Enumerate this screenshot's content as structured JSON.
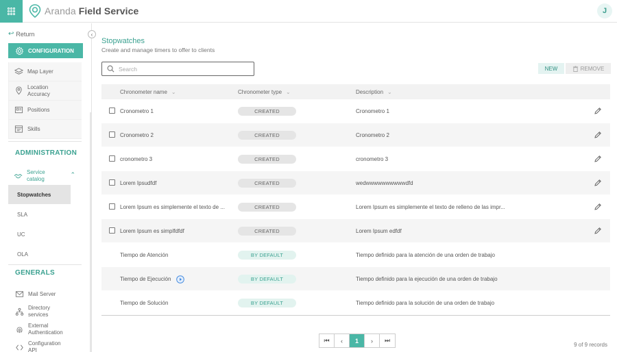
{
  "app": {
    "brand_light": "Aranda",
    "brand_bold": "Field Service",
    "user_initial": "J",
    "accent_color": "#4ab7a6"
  },
  "sidebar": {
    "return_label": "Return",
    "config_label": "CONFIGURATION",
    "config_items": [
      {
        "label": "Map Layer",
        "icon": "map-layer-icon"
      },
      {
        "label": "Location Accuracy",
        "icon": "location-pin-icon"
      },
      {
        "label": "Positions",
        "icon": "positions-icon"
      },
      {
        "label": "Skills",
        "icon": "skills-icon"
      }
    ],
    "administration_title": "ADMINISTRATION",
    "service_catalog_label": "Service catalog",
    "catalog_items": [
      "Stopwatches",
      "SLA",
      "UC",
      "OLA"
    ],
    "generals_title": "GENERALS",
    "general_items": [
      {
        "label": "Mail Server",
        "icon": "mail-icon"
      },
      {
        "label": "Directory services",
        "icon": "directory-icon"
      },
      {
        "label": "External Authentication",
        "icon": "fingerprint-icon"
      },
      {
        "label": "Configuration API",
        "icon": "api-icon"
      }
    ]
  },
  "main": {
    "title": "Stopwatches",
    "subtitle": "Create and manage timers to offer to clients",
    "search_placeholder": "Search",
    "new_label": "NEW",
    "remove_label": "REMOVE",
    "columns": [
      "Chronometer name",
      "Chronometer type",
      "Description"
    ],
    "rows": [
      {
        "name": "Cronometro 1",
        "type": "CREATED",
        "description": "Cronometro 1",
        "selectable": true,
        "editable": true
      },
      {
        "name": "Cronometro 2",
        "type": "CREATED",
        "description": "Cronometro 2",
        "selectable": true,
        "editable": true
      },
      {
        "name": "cronometro 3",
        "type": "CREATED",
        "description": "cronometro 3",
        "selectable": true,
        "editable": true
      },
      {
        "name": "Lorem Ipsudfdf",
        "type": "CREATED",
        "description": "wedwwwwwwwwwwdfd",
        "selectable": true,
        "editable": true
      },
      {
        "name": "Lorem Ipsum es simplemente el texto de ...",
        "type": "CREATED",
        "description": "Lorem Ipsum es simplemente el texto de relleno de las impr...",
        "selectable": true,
        "editable": true
      },
      {
        "name": "Lorem Ipsum es simplfdfdf",
        "type": "CREATED",
        "description": "Lorem Ipsum edfdf",
        "selectable": true,
        "editable": true
      },
      {
        "name": "Tiempo de Atención",
        "type": "BY DEFAULT",
        "description": "Tiempo definido para la atención de una orden de trabajo",
        "selectable": false,
        "editable": false
      },
      {
        "name": "Tiempo de Ejecución",
        "type": "BY DEFAULT",
        "description": "Tiempo definido para la ejecución de una orden de trabajo",
        "selectable": false,
        "editable": false,
        "timer": true
      },
      {
        "name": "Tiempo de Solución",
        "type": "BY DEFAULT",
        "description": "Tiempo definido para la solución de una orden de trabajo",
        "selectable": false,
        "editable": false
      }
    ],
    "pagination": {
      "current_page": "1"
    },
    "records_text": "9 of 9 records"
  }
}
